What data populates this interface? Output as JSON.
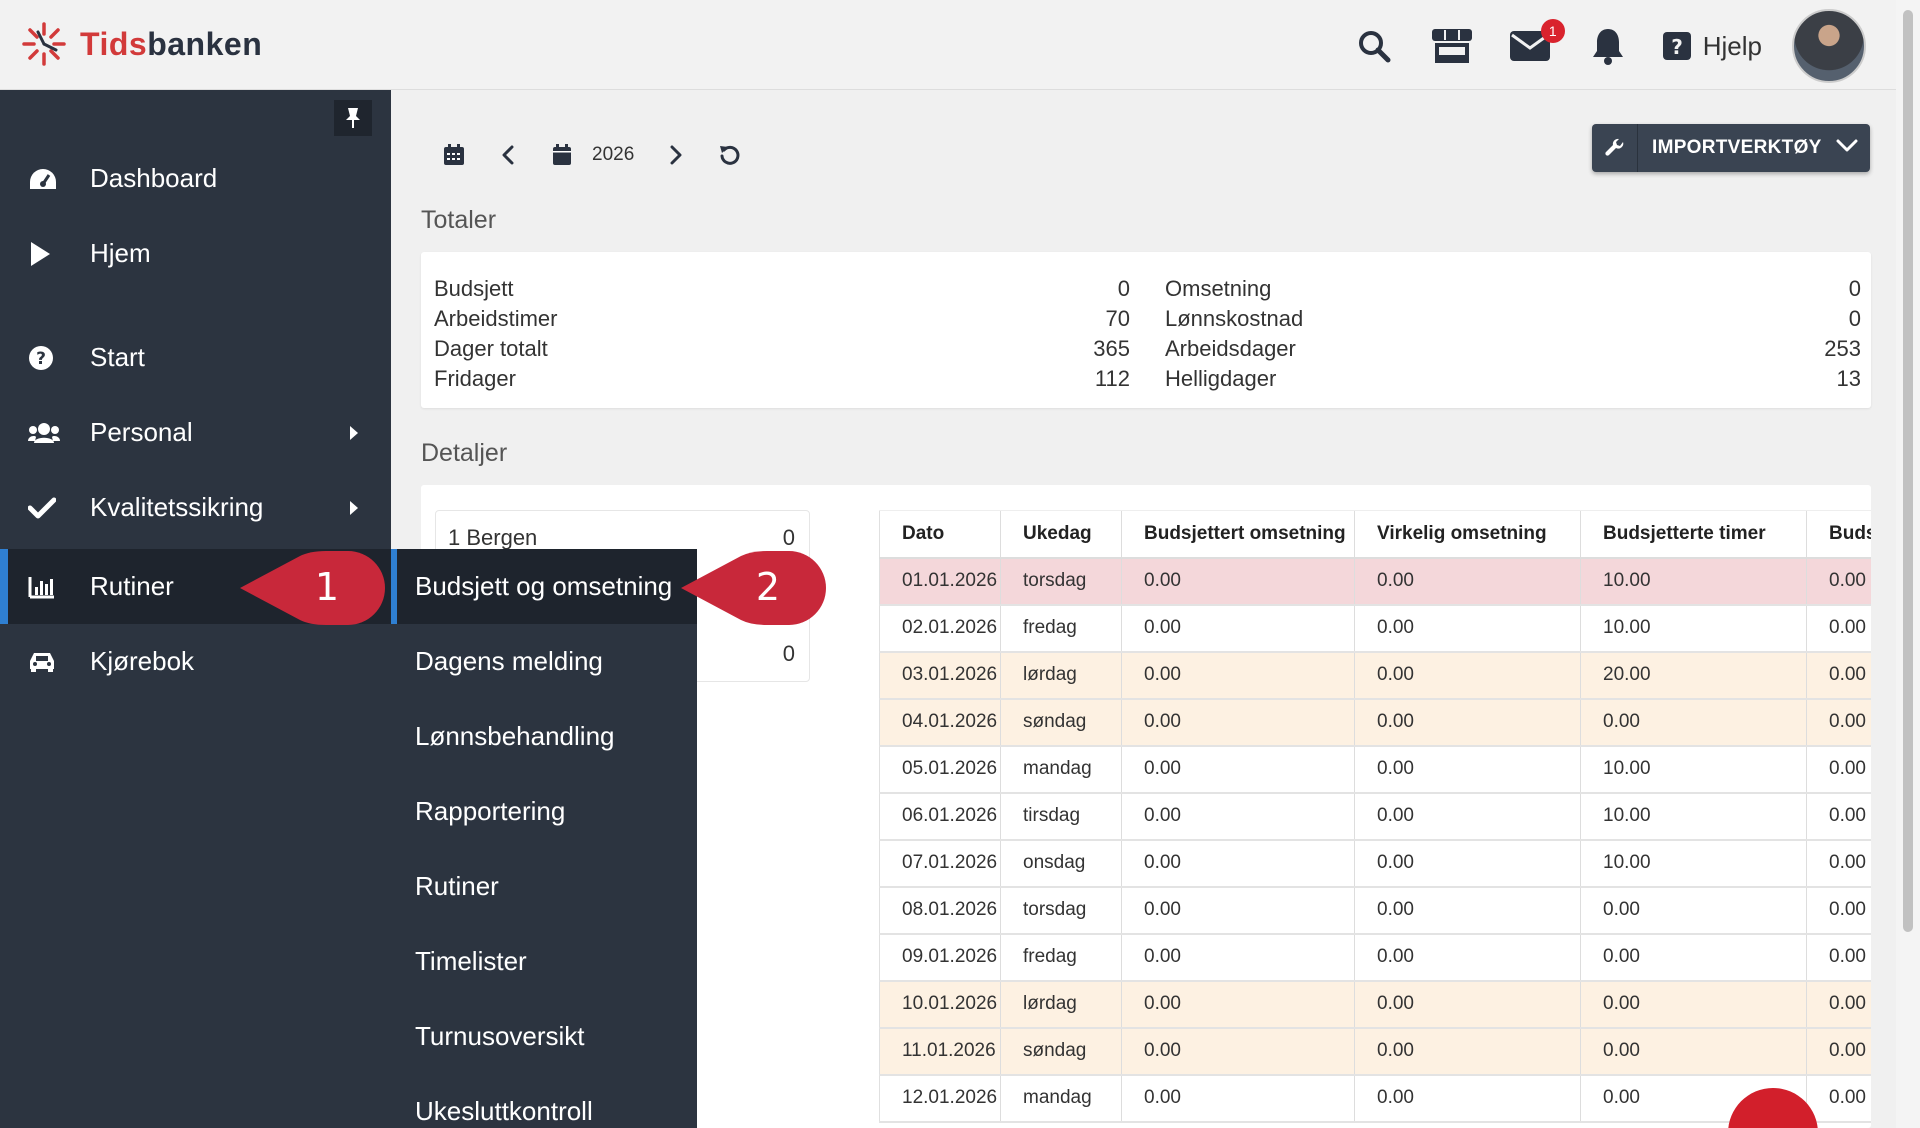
{
  "brand": {
    "name_part1": "Tids",
    "name_part2": "banken"
  },
  "header": {
    "mail_badge": "1",
    "help_label": "Hjelp",
    "icons": [
      "search-icon",
      "store-icon",
      "mail-icon",
      "bell-icon",
      "help-icon"
    ]
  },
  "sidebar": {
    "items": [
      {
        "label": "Dashboard",
        "icon": "dashboard-icon"
      },
      {
        "label": "Hjem",
        "icon": "play-icon"
      },
      {
        "label": "Start",
        "icon": "question-icon"
      },
      {
        "label": "Personal",
        "icon": "users-icon"
      },
      {
        "label": "Kvalitetssikring",
        "icon": "check-icon"
      },
      {
        "label": "Rutiner",
        "icon": "chart-icon"
      },
      {
        "label": "Kjørebok",
        "icon": "car-icon"
      }
    ]
  },
  "submenu": {
    "items": [
      "Budsjett og omsetning",
      "Dagens melding",
      "Lønnsbehandling",
      "Rapportering",
      "Rutiner",
      "Timelister",
      "Turnusoversikt",
      "Ukesluttkontroll"
    ]
  },
  "callouts": {
    "first": "1",
    "second": "2"
  },
  "toolbar": {
    "year": "2026",
    "import_label": "IMPORTVERKTØY"
  },
  "totals": {
    "title": "Totaler",
    "left": [
      {
        "label": "Budsjett",
        "value": "0"
      },
      {
        "label": "Arbeidstimer",
        "value": "70"
      },
      {
        "label": "Dager totalt",
        "value": "365"
      },
      {
        "label": "Fridager",
        "value": "112"
      }
    ],
    "right": [
      {
        "label": "Omsetning",
        "value": "0"
      },
      {
        "label": "Lønnskostnad",
        "value": "0"
      },
      {
        "label": "Arbeidsdager",
        "value": "253"
      },
      {
        "label": "Helligdager",
        "value": "13"
      }
    ]
  },
  "details": {
    "title": "Detaljer",
    "location_label": "1 Bergen",
    "location_value": "0",
    "second_value": "0",
    "columns": [
      "Dato",
      "Ukedag",
      "Budsjettert omsetning",
      "Virkelig omsetning",
      "Budsjetterte timer",
      "Budsjetterte"
    ],
    "rows": [
      {
        "type": "red",
        "cells": [
          "01.01.2026",
          "torsdag",
          "0.00",
          "0.00",
          "10.00",
          "0.00"
        ]
      },
      {
        "type": "",
        "cells": [
          "02.01.2026",
          "fredag",
          "0.00",
          "0.00",
          "10.00",
          "0.00"
        ]
      },
      {
        "type": "peach",
        "cells": [
          "03.01.2026",
          "lørdag",
          "0.00",
          "0.00",
          "20.00",
          "0.00"
        ]
      },
      {
        "type": "peach",
        "cells": [
          "04.01.2026",
          "søndag",
          "0.00",
          "0.00",
          "0.00",
          "0.00"
        ]
      },
      {
        "type": "",
        "cells": [
          "05.01.2026",
          "mandag",
          "0.00",
          "0.00",
          "10.00",
          "0.00"
        ]
      },
      {
        "type": "",
        "cells": [
          "06.01.2026",
          "tirsdag",
          "0.00",
          "0.00",
          "10.00",
          "0.00"
        ]
      },
      {
        "type": "",
        "cells": [
          "07.01.2026",
          "onsdag",
          "0.00",
          "0.00",
          "10.00",
          "0.00"
        ]
      },
      {
        "type": "",
        "cells": [
          "08.01.2026",
          "torsdag",
          "0.00",
          "0.00",
          "0.00",
          "0.00"
        ]
      },
      {
        "type": "",
        "cells": [
          "09.01.2026",
          "fredag",
          "0.00",
          "0.00",
          "0.00",
          "0.00"
        ]
      },
      {
        "type": "peach",
        "cells": [
          "10.01.2026",
          "lørdag",
          "0.00",
          "0.00",
          "0.00",
          "0.00"
        ]
      },
      {
        "type": "peach",
        "cells": [
          "11.01.2026",
          "søndag",
          "0.00",
          "0.00",
          "0.00",
          "0.00"
        ]
      },
      {
        "type": "",
        "cells": [
          "12.01.2026",
          "mandag",
          "0.00",
          "0.00",
          "0.00",
          "0.00"
        ]
      }
    ]
  },
  "colors": {
    "accent_blue": "#2f7fd1",
    "callout_red": "#c8283a",
    "sidebar_bg": "#2c3440"
  }
}
